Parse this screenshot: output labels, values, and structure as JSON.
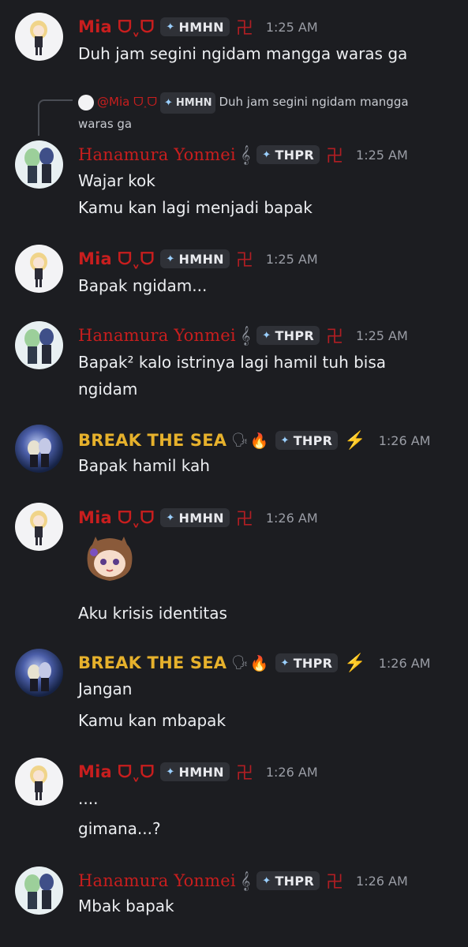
{
  "colors": {
    "background": "#1c1d21",
    "name_red": "#c81e1e",
    "name_gold": "#e6b12c",
    "timestamp": "#9a9da5",
    "message_text": "#eceef1",
    "tag_bg": "#2f3137"
  },
  "reply": {
    "name": "@Mia ᗜ˰ᗜ",
    "tag": "HMHN",
    "text": "Duh jam segini ngidam mangga waras ga"
  },
  "messages": [
    {
      "author": "Mia ᗜˬᗜ",
      "tag": "HMHN",
      "badge": "卍",
      "time": "1:25 AM",
      "lines": [
        "Duh jam segini ngidam mangga waras ga"
      ]
    },
    {
      "author": "Hanamura Yonmei",
      "deco": "𝄞",
      "tag": "THPR",
      "badge": "卍",
      "time": "1:25 AM",
      "lines": [
        "Wajar kok",
        "Kamu kan lagi menjadi bapak"
      ]
    },
    {
      "author": "Mia ᗜˬᗜ",
      "tag": "HMHN",
      "badge": "卍",
      "time": "1:25 AM",
      "lines": [
        "Bapak ngidam..."
      ]
    },
    {
      "author": "Hanamura Yonmei",
      "deco": "𝄞",
      "tag": "THPR",
      "badge": "卍",
      "time": "1:25 AM",
      "lines": [
        "Bapak² kalo istrinya lagi hamil tuh bisa",
        "ngidam"
      ]
    },
    {
      "author": "BREAK THE SEA",
      "tag": "THPR",
      "badge": "⚡",
      "time": "1:26 AM",
      "lines": [
        "Bapak hamil kah"
      ]
    },
    {
      "author": "Mia ᗜˬᗜ",
      "tag": "HMHN",
      "badge": "卍",
      "time": "1:26 AM",
      "sticker": "chibi-girl-sticker",
      "lines": [
        "Aku krisis identitas"
      ]
    },
    {
      "author": "BREAK THE SEA",
      "tag": "THPR",
      "badge": "⚡",
      "time": "1:26 AM",
      "lines": [
        "Jangan",
        "Kamu kan mbapak"
      ]
    },
    {
      "author": "Mia ᗜˬᗜ",
      "tag": "HMHN",
      "badge": "卍",
      "time": "1:26 AM",
      "lines": [
        "....",
        "gimana...?"
      ]
    },
    {
      "author": "Hanamura Yonmei",
      "deco": "𝄞",
      "tag": "THPR",
      "badge": "卍",
      "time": "1:26 AM",
      "lines": [
        "Mbak bapak"
      ]
    }
  ]
}
